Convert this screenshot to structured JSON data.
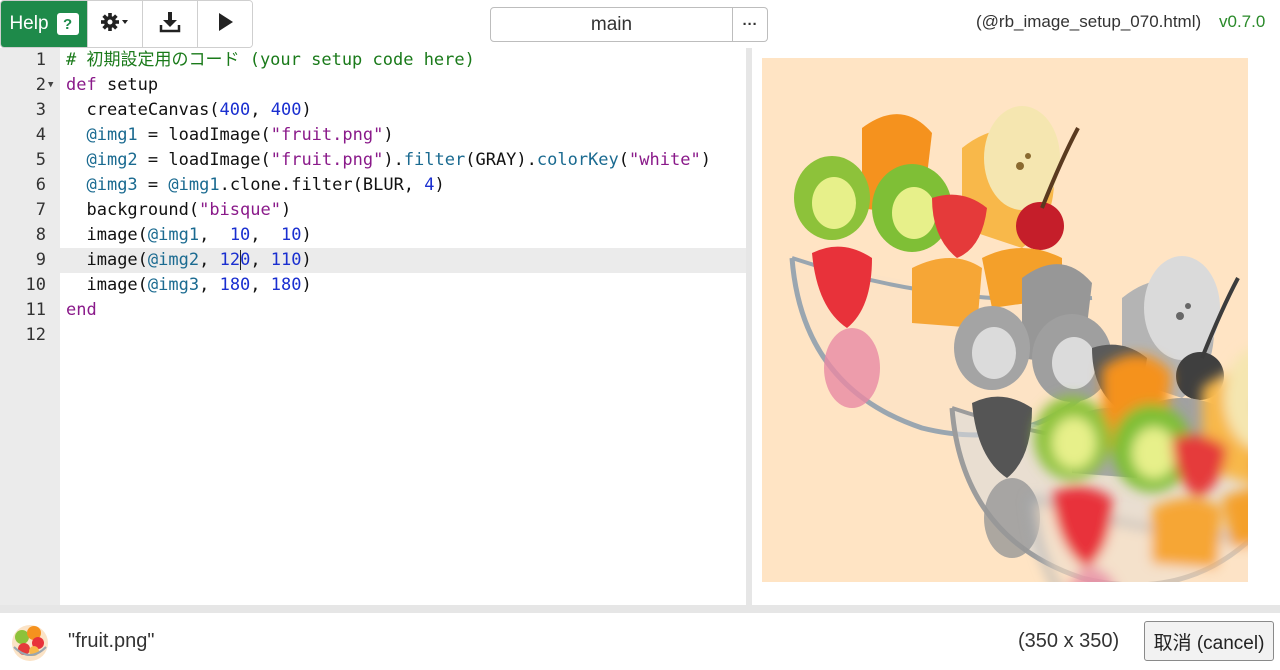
{
  "toolbar": {
    "help_label": "Help",
    "help_badge": "?",
    "icons": [
      "gear-icon",
      "download-icon",
      "play-icon"
    ],
    "file_select": "main",
    "file_more": "···",
    "filename": "(@rb_image_setup_070.html)",
    "version": "v0.7.0"
  },
  "editor": {
    "lines": [
      {
        "num": "1"
      },
      {
        "num": "2"
      },
      {
        "num": "3"
      },
      {
        "num": "4"
      },
      {
        "num": "5"
      },
      {
        "num": "6"
      },
      {
        "num": "7"
      },
      {
        "num": "8"
      },
      {
        "num": "9"
      },
      {
        "num": "10"
      },
      {
        "num": "11"
      },
      {
        "num": "12"
      }
    ],
    "code": {
      "l1": "# 初期設定用のコード (your setup code here)",
      "l2_kw": "def",
      "l2_name": " setup",
      "l3_fn": "createCanvas(",
      "l3_a": "400",
      "l3_sep": ", ",
      "l3_b": "400",
      "l3_end": ")",
      "l4_var": "@img1",
      "l4_mid": " = loadImage(",
      "l4_str": "\"fruit.png\"",
      "l4_end": ")",
      "l5_var": "@img2",
      "l5_mid": " = loadImage(",
      "l5_str": "\"fruit.png\"",
      "l5_p": ").",
      "l5_m1": "filter",
      "l5_arg1": "(GRAY).",
      "l5_m2": "colorKey",
      "l5_open": "(",
      "l5_str2": "\"white\"",
      "l5_end": ")",
      "l6_var": "@img3",
      "l6_eq": " = ",
      "l6_var2": "@img1",
      "l6_mid": ".clone.filter(BLUR, ",
      "l6_num": "4",
      "l6_end": ")",
      "l7_fn": "background(",
      "l7_str": "\"bisque\"",
      "l7_end": ")",
      "l8_fn": "image(",
      "l8_var": "@img1",
      "l8_s1": ",  ",
      "l8_a": "10",
      "l8_s2": ",  ",
      "l8_b": "10",
      "l8_end": ")",
      "l9_fn": "image(",
      "l9_var": "@img2",
      "l9_s1": ", ",
      "l9_a1": "12",
      "l9_a2": "0",
      "l9_s2": ", ",
      "l9_b": "110",
      "l9_end": ")",
      "l10_fn": "image(",
      "l10_var": "@img3",
      "l10_s1": ", ",
      "l10_a": "180",
      "l10_s2": ", ",
      "l10_b": "180",
      "l10_end": ")",
      "l11_kw": "end"
    }
  },
  "preview": {
    "background": "#ffe4c4"
  },
  "bottom": {
    "thumb_name": "\"fruit.png\"",
    "dims": "(350 x 350)",
    "cancel_label": "取消 (cancel)"
  },
  "colors": {
    "help_green": "#1e8a4a",
    "version_green": "#2a8a2a"
  }
}
